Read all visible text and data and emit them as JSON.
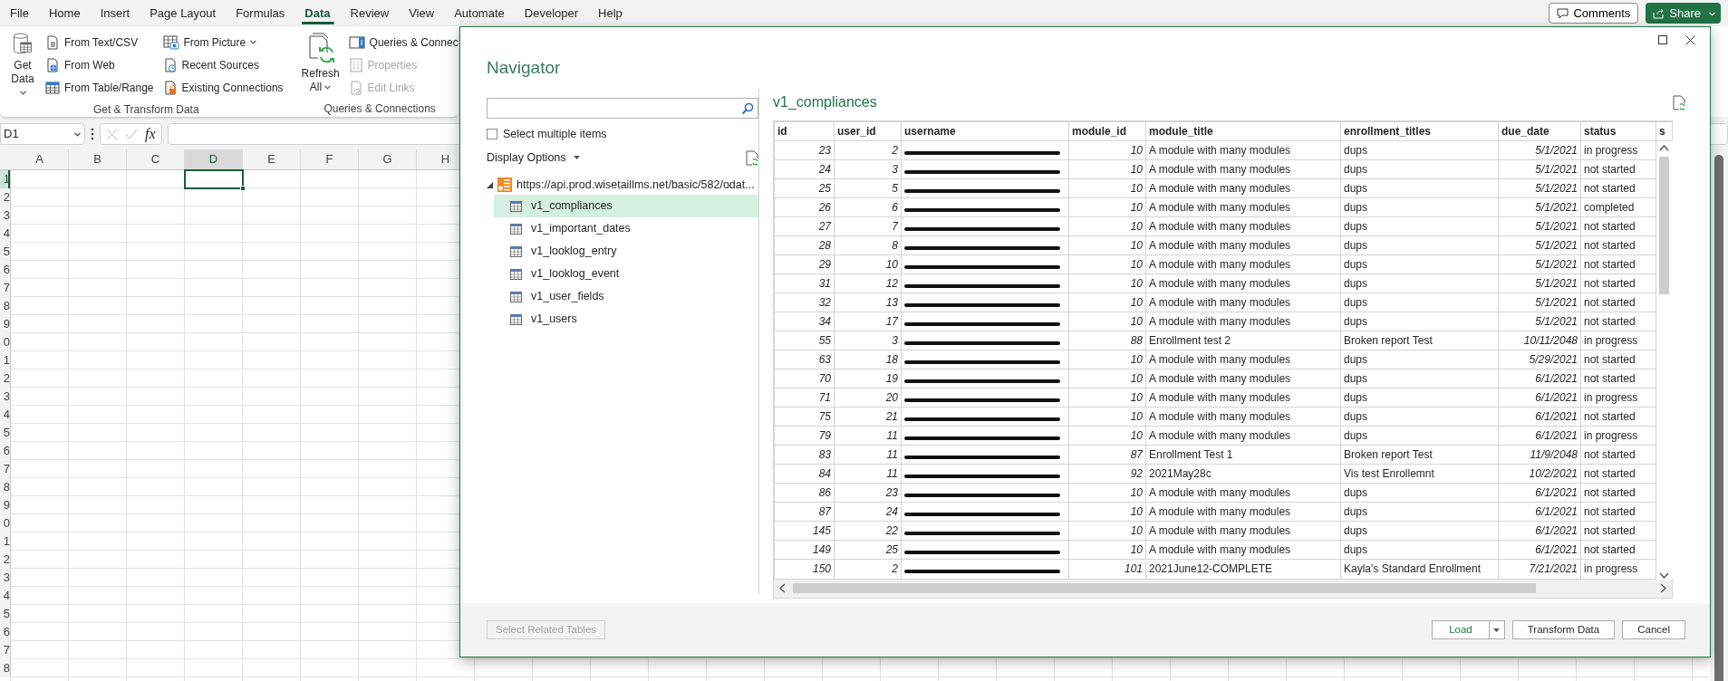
{
  "ribbon_tabs": [
    {
      "label": "File",
      "selected": false
    },
    {
      "label": "Home",
      "selected": false
    },
    {
      "label": "Insert",
      "selected": false
    },
    {
      "label": "Page Layout",
      "selected": false
    },
    {
      "label": "Formulas",
      "selected": false
    },
    {
      "label": "Data",
      "selected": true
    },
    {
      "label": "Review",
      "selected": false
    },
    {
      "label": "View",
      "selected": false
    },
    {
      "label": "Automate",
      "selected": false
    },
    {
      "label": "Developer",
      "selected": false
    },
    {
      "label": "Help",
      "selected": false
    }
  ],
  "top_buttons": [
    {
      "kind": "comments",
      "label": "Comments"
    },
    {
      "kind": "share",
      "label": "Share"
    }
  ],
  "ribbon_groups": [
    {
      "label": "Get & Transform Data",
      "large": {
        "kind": "database",
        "lines": [
          "Get",
          "Data"
        ],
        "dropdown": true
      },
      "columns": [
        [
          {
            "kind": "text-file",
            "label": "From Text/CSV",
            "disabled": false,
            "dropdown": false
          },
          {
            "kind": "web-file",
            "label": "From Web",
            "disabled": false,
            "dropdown": false
          },
          {
            "kind": "table",
            "label": "From Table/Range",
            "disabled": false,
            "dropdown": false
          }
        ],
        [
          {
            "kind": "picture",
            "label": "From Picture",
            "disabled": false,
            "dropdown": true
          },
          {
            "kind": "clock-file",
            "label": "Recent Sources",
            "disabled": false,
            "dropdown": false
          },
          {
            "kind": "lock-file",
            "label": "Existing Connections",
            "disabled": false,
            "dropdown": false
          }
        ]
      ]
    },
    {
      "label": "Queries & Connections",
      "large": {
        "kind": "refresh",
        "lines": [
          "Refresh",
          "All"
        ],
        "dropdown": true
      },
      "columns": [
        [
          {
            "kind": "panel",
            "label": "Queries & Connec",
            "disabled": false,
            "dropdown": false
          },
          {
            "kind": "properties",
            "label": "Properties",
            "disabled": true,
            "dropdown": false
          },
          {
            "kind": "link-file",
            "label": "Edit Links",
            "disabled": true,
            "dropdown": false
          }
        ]
      ]
    }
  ],
  "formula_bar": {
    "name_box": "D1",
    "function_label": "fx"
  },
  "sheet": {
    "columns": [
      {
        "label": "A",
        "selected": false
      },
      {
        "label": "B",
        "selected": false
      },
      {
        "label": "C",
        "selected": false
      },
      {
        "label": "D",
        "selected": true
      },
      {
        "label": "E",
        "selected": false
      },
      {
        "label": "F",
        "selected": false
      },
      {
        "label": "G",
        "selected": false
      },
      {
        "label": "H",
        "selected": false
      }
    ],
    "rows": [
      {
        "label": "1",
        "selected": true
      },
      {
        "label": "2",
        "selected": false
      },
      {
        "label": "3",
        "selected": false
      },
      {
        "label": "4",
        "selected": false
      },
      {
        "label": "5",
        "selected": false
      },
      {
        "label": "6",
        "selected": false
      },
      {
        "label": "7",
        "selected": false
      },
      {
        "label": "8",
        "selected": false
      },
      {
        "label": "9",
        "selected": false
      },
      {
        "label": "0",
        "selected": false
      },
      {
        "label": "1",
        "selected": false
      },
      {
        "label": "2",
        "selected": false
      },
      {
        "label": "3",
        "selected": false
      },
      {
        "label": "4",
        "selected": false
      },
      {
        "label": "5",
        "selected": false
      },
      {
        "label": "6",
        "selected": false
      },
      {
        "label": "7",
        "selected": false
      },
      {
        "label": "8",
        "selected": false
      },
      {
        "label": "9",
        "selected": false
      },
      {
        "label": "0",
        "selected": false
      },
      {
        "label": "1",
        "selected": false
      },
      {
        "label": "2",
        "selected": false
      },
      {
        "label": "3",
        "selected": false
      },
      {
        "label": "4",
        "selected": false
      },
      {
        "label": "5",
        "selected": false
      },
      {
        "label": "6",
        "selected": false
      },
      {
        "label": "7",
        "selected": false
      },
      {
        "label": "8",
        "selected": false
      }
    ]
  },
  "navigator": {
    "title": "Navigator",
    "select_multiple": {
      "label": "Select multiple items",
      "checked": false
    },
    "display_options": "Display Options",
    "tree": {
      "label": "https://api.prod.wisetaillms.net/basic/582/odat...",
      "expanded": true,
      "children": [
        {
          "label": "v1_compliances",
          "selected": true
        },
        {
          "label": "v1_important_dates",
          "selected": false
        },
        {
          "label": "v1_looklog_entry",
          "selected": false
        },
        {
          "label": "v1_looklog_event",
          "selected": false
        },
        {
          "label": "v1_user_fields",
          "selected": false
        },
        {
          "label": "v1_users",
          "selected": false
        }
      ]
    },
    "preview": {
      "title": "v1_compliances",
      "columns": [
        "id",
        "user_id",
        "username",
        "module_id",
        "module_title",
        "enrollment_titles",
        "due_date",
        "status",
        "s"
      ],
      "rows": [
        [
          {
            "kind": "number",
            "text": "23"
          },
          {
            "kind": "number",
            "text": "2"
          },
          {
            "kind": "redacted"
          },
          {
            "kind": "number",
            "text": "10"
          },
          {
            "kind": "text",
            "text": "A module with many modules"
          },
          {
            "kind": "text",
            "text": "dups"
          },
          {
            "kind": "number",
            "text": "5/1/2021"
          },
          {
            "kind": "text",
            "text": "in progress"
          }
        ],
        [
          {
            "kind": "number",
            "text": "24"
          },
          {
            "kind": "number",
            "text": "3"
          },
          {
            "kind": "redacted"
          },
          {
            "kind": "number",
            "text": "10"
          },
          {
            "kind": "text",
            "text": "A module with many modules"
          },
          {
            "kind": "text",
            "text": "dups"
          },
          {
            "kind": "number",
            "text": "5/1/2021"
          },
          {
            "kind": "text",
            "text": "not started"
          }
        ],
        [
          {
            "kind": "number",
            "text": "25"
          },
          {
            "kind": "number",
            "text": "5"
          },
          {
            "kind": "redacted"
          },
          {
            "kind": "number",
            "text": "10"
          },
          {
            "kind": "text",
            "text": "A module with many modules"
          },
          {
            "kind": "text",
            "text": "dups"
          },
          {
            "kind": "number",
            "text": "5/1/2021"
          },
          {
            "kind": "text",
            "text": "not started"
          }
        ],
        [
          {
            "kind": "number",
            "text": "26"
          },
          {
            "kind": "number",
            "text": "6"
          },
          {
            "kind": "redacted"
          },
          {
            "kind": "number",
            "text": "10"
          },
          {
            "kind": "text",
            "text": "A module with many modules"
          },
          {
            "kind": "text",
            "text": "dups"
          },
          {
            "kind": "number",
            "text": "5/1/2021"
          },
          {
            "kind": "text",
            "text": "completed"
          }
        ],
        [
          {
            "kind": "number",
            "text": "27"
          },
          {
            "kind": "number",
            "text": "7"
          },
          {
            "kind": "redacted"
          },
          {
            "kind": "number",
            "text": "10"
          },
          {
            "kind": "text",
            "text": "A module with many modules"
          },
          {
            "kind": "text",
            "text": "dups"
          },
          {
            "kind": "number",
            "text": "5/1/2021"
          },
          {
            "kind": "text",
            "text": "not started"
          }
        ],
        [
          {
            "kind": "number",
            "text": "28"
          },
          {
            "kind": "number",
            "text": "8"
          },
          {
            "kind": "redacted"
          },
          {
            "kind": "number",
            "text": "10"
          },
          {
            "kind": "text",
            "text": "A module with many modules"
          },
          {
            "kind": "text",
            "text": "dups"
          },
          {
            "kind": "number",
            "text": "5/1/2021"
          },
          {
            "kind": "text",
            "text": "not started"
          }
        ],
        [
          {
            "kind": "number",
            "text": "29"
          },
          {
            "kind": "number",
            "text": "10"
          },
          {
            "kind": "redacted"
          },
          {
            "kind": "number",
            "text": "10"
          },
          {
            "kind": "text",
            "text": "A module with many modules"
          },
          {
            "kind": "text",
            "text": "dups"
          },
          {
            "kind": "number",
            "text": "5/1/2021"
          },
          {
            "kind": "text",
            "text": "not started"
          }
        ],
        [
          {
            "kind": "number",
            "text": "31"
          },
          {
            "kind": "number",
            "text": "12"
          },
          {
            "kind": "redacted"
          },
          {
            "kind": "number",
            "text": "10"
          },
          {
            "kind": "text",
            "text": "A module with many modules"
          },
          {
            "kind": "text",
            "text": "dups"
          },
          {
            "kind": "number",
            "text": "5/1/2021"
          },
          {
            "kind": "text",
            "text": "not started"
          }
        ],
        [
          {
            "kind": "number",
            "text": "32"
          },
          {
            "kind": "number",
            "text": "13"
          },
          {
            "kind": "redacted"
          },
          {
            "kind": "number",
            "text": "10"
          },
          {
            "kind": "text",
            "text": "A module with many modules"
          },
          {
            "kind": "text",
            "text": "dups"
          },
          {
            "kind": "number",
            "text": "5/1/2021"
          },
          {
            "kind": "text",
            "text": "not started"
          }
        ],
        [
          {
            "kind": "number",
            "text": "34"
          },
          {
            "kind": "number",
            "text": "17"
          },
          {
            "kind": "redacted"
          },
          {
            "kind": "number",
            "text": "10"
          },
          {
            "kind": "text",
            "text": "A module with many modules"
          },
          {
            "kind": "text",
            "text": "dups"
          },
          {
            "kind": "number",
            "text": "5/1/2021"
          },
          {
            "kind": "text",
            "text": "not started"
          }
        ],
        [
          {
            "kind": "number",
            "text": "55"
          },
          {
            "kind": "number",
            "text": "3"
          },
          {
            "kind": "redacted"
          },
          {
            "kind": "number",
            "text": "88"
          },
          {
            "kind": "text",
            "text": "Enrollment test 2"
          },
          {
            "kind": "text",
            "text": "Broken report Test"
          },
          {
            "kind": "number",
            "text": "10/11/2048"
          },
          {
            "kind": "text",
            "text": "in progress"
          }
        ],
        [
          {
            "kind": "number",
            "text": "63"
          },
          {
            "kind": "number",
            "text": "18"
          },
          {
            "kind": "redacted"
          },
          {
            "kind": "number",
            "text": "10"
          },
          {
            "kind": "text",
            "text": "A module with many modules"
          },
          {
            "kind": "text",
            "text": "dups"
          },
          {
            "kind": "number",
            "text": "5/29/2021"
          },
          {
            "kind": "text",
            "text": "not started"
          }
        ],
        [
          {
            "kind": "number",
            "text": "70"
          },
          {
            "kind": "number",
            "text": "19"
          },
          {
            "kind": "redacted"
          },
          {
            "kind": "number",
            "text": "10"
          },
          {
            "kind": "text",
            "text": "A module with many modules"
          },
          {
            "kind": "text",
            "text": "dups"
          },
          {
            "kind": "number",
            "text": "6/1/2021"
          },
          {
            "kind": "text",
            "text": "not started"
          }
        ],
        [
          {
            "kind": "number",
            "text": "71"
          },
          {
            "kind": "number",
            "text": "20"
          },
          {
            "kind": "redacted"
          },
          {
            "kind": "number",
            "text": "10"
          },
          {
            "kind": "text",
            "text": "A module with many modules"
          },
          {
            "kind": "text",
            "text": "dups"
          },
          {
            "kind": "number",
            "text": "6/1/2021"
          },
          {
            "kind": "text",
            "text": "in progress"
          }
        ],
        [
          {
            "kind": "number",
            "text": "75"
          },
          {
            "kind": "number",
            "text": "21"
          },
          {
            "kind": "redacted"
          },
          {
            "kind": "number",
            "text": "10"
          },
          {
            "kind": "text",
            "text": "A module with many modules"
          },
          {
            "kind": "text",
            "text": "dups"
          },
          {
            "kind": "number",
            "text": "6/1/2021"
          },
          {
            "kind": "text",
            "text": "not started"
          }
        ],
        [
          {
            "kind": "number",
            "text": "79"
          },
          {
            "kind": "number",
            "text": "11"
          },
          {
            "kind": "redacted"
          },
          {
            "kind": "number",
            "text": "10"
          },
          {
            "kind": "text",
            "text": "A module with many modules"
          },
          {
            "kind": "text",
            "text": "dups"
          },
          {
            "kind": "number",
            "text": "6/1/2021"
          },
          {
            "kind": "text",
            "text": "in progress"
          }
        ],
        [
          {
            "kind": "number",
            "text": "83"
          },
          {
            "kind": "number",
            "text": "11"
          },
          {
            "kind": "redacted"
          },
          {
            "kind": "number",
            "text": "87"
          },
          {
            "kind": "text",
            "text": "Enrollment Test 1"
          },
          {
            "kind": "text",
            "text": "Broken report Test"
          },
          {
            "kind": "number",
            "text": "11/9/2048"
          },
          {
            "kind": "text",
            "text": "not started"
          }
        ],
        [
          {
            "kind": "number",
            "text": "84"
          },
          {
            "kind": "number",
            "text": "11"
          },
          {
            "kind": "redacted"
          },
          {
            "kind": "number",
            "text": "92"
          },
          {
            "kind": "text",
            "text": "2021May28c"
          },
          {
            "kind": "text",
            "text": "Vis test Enrollemnt"
          },
          {
            "kind": "number",
            "text": "10/2/2021"
          },
          {
            "kind": "text",
            "text": "not started"
          }
        ],
        [
          {
            "kind": "number",
            "text": "86"
          },
          {
            "kind": "number",
            "text": "23"
          },
          {
            "kind": "redacted"
          },
          {
            "kind": "number",
            "text": "10"
          },
          {
            "kind": "text",
            "text": "A module with many modules"
          },
          {
            "kind": "text",
            "text": "dups"
          },
          {
            "kind": "number",
            "text": "6/1/2021"
          },
          {
            "kind": "text",
            "text": "not started"
          }
        ],
        [
          {
            "kind": "number",
            "text": "87"
          },
          {
            "kind": "number",
            "text": "24"
          },
          {
            "kind": "redacted"
          },
          {
            "kind": "number",
            "text": "10"
          },
          {
            "kind": "text",
            "text": "A module with many modules"
          },
          {
            "kind": "text",
            "text": "dups"
          },
          {
            "kind": "number",
            "text": "6/1/2021"
          },
          {
            "kind": "text",
            "text": "not started"
          }
        ],
        [
          {
            "kind": "number",
            "text": "145"
          },
          {
            "kind": "number",
            "text": "22"
          },
          {
            "kind": "redacted"
          },
          {
            "kind": "number",
            "text": "10"
          },
          {
            "kind": "text",
            "text": "A module with many modules"
          },
          {
            "kind": "text",
            "text": "dups"
          },
          {
            "kind": "number",
            "text": "6/1/2021"
          },
          {
            "kind": "text",
            "text": "not started"
          }
        ],
        [
          {
            "kind": "number",
            "text": "149"
          },
          {
            "kind": "number",
            "text": "25"
          },
          {
            "kind": "redacted"
          },
          {
            "kind": "number",
            "text": "10"
          },
          {
            "kind": "text",
            "text": "A module with many modules"
          },
          {
            "kind": "text",
            "text": "dups"
          },
          {
            "kind": "number",
            "text": "6/1/2021"
          },
          {
            "kind": "text",
            "text": "not started"
          }
        ],
        [
          {
            "kind": "number",
            "text": "150"
          },
          {
            "kind": "number",
            "text": "2"
          },
          {
            "kind": "redacted"
          },
          {
            "kind": "number",
            "text": "101"
          },
          {
            "kind": "text",
            "text": "2021June12-COMPLETE"
          },
          {
            "kind": "text",
            "text": "Kayla's Standard Enrollment"
          },
          {
            "kind": "number",
            "text": "7/21/2021"
          },
          {
            "kind": "text",
            "text": "in progress"
          }
        ]
      ]
    },
    "footer": {
      "related": {
        "label": "Select Related Tables",
        "disabled": true
      },
      "buttons": [
        {
          "kind": "split",
          "label": "Load"
        },
        {
          "kind": "plain",
          "label": "Transform Data"
        },
        {
          "kind": "plain",
          "label": "Cancel"
        }
      ]
    }
  }
}
